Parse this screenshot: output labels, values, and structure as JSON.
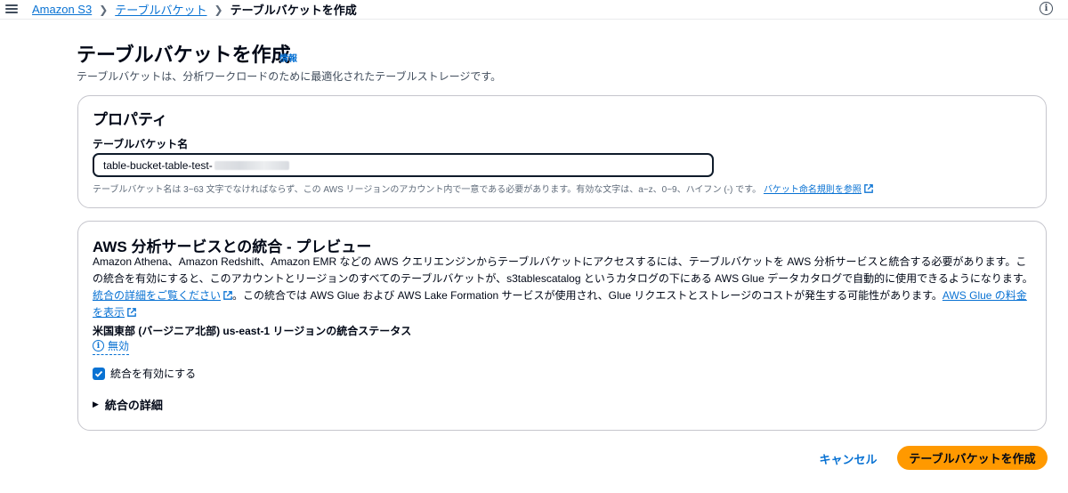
{
  "breadcrumb": {
    "items": [
      "Amazon S3",
      "テーブルバケット"
    ],
    "current": "テーブルバケットを作成"
  },
  "header": {
    "title": "テーブルバケットを作成",
    "info_link": "情報",
    "description": "テーブルバケットは、分析ワークロードのために最適化されたテーブルストレージです。"
  },
  "properties": {
    "title": "プロパティ",
    "name_label": "テーブルバケット名",
    "name_value": "table-bucket-table-test-",
    "constraint_text": "テーブルバケット名は 3~63 文字でなければならず、この AWS リージョンのアカウント内で一意である必要があります。有効な文字は、a~z、0~9、ハイフン (-) です。",
    "constraint_link": "バケット命名規則を参照"
  },
  "integration": {
    "title": "AWS 分析サービスとの統合 - プレビュー",
    "para_part1": "Amazon Athena、Amazon Redshift、Amazon EMR などの AWS クエリエンジンからテーブルバケットにアクセスするには、テーブルバケットを AWS 分析サービスと統合する必要があります。この統合を有効にすると、このアカウントとリージョンのすべてのテーブルバケットが、s3tablescatalog というカタログの下にある AWS Glue データカタログで自動的に使用できるようになります。",
    "link_details": "統合の詳細をご覧ください",
    "para_part2": "。この統合では AWS Glue および AWS Lake Formation サービスが使用され、Glue リクエストとストレージのコストが発生する可能性があります。",
    "link_pricing": "AWS Glue の料金を表示",
    "status_label": "米国東部 (バージニア北部) us-east-1 リージョンの統合ステータス",
    "status_value": "無効",
    "checkbox_label": "統合を有効にする",
    "checkbox_checked": true,
    "details_label": "統合の詳細"
  },
  "actions": {
    "cancel": "キャンセル",
    "create": "テーブルバケットを作成"
  },
  "colors": {
    "link": "#0972d3",
    "primary_button": "#ff9900",
    "text": "#000716"
  }
}
